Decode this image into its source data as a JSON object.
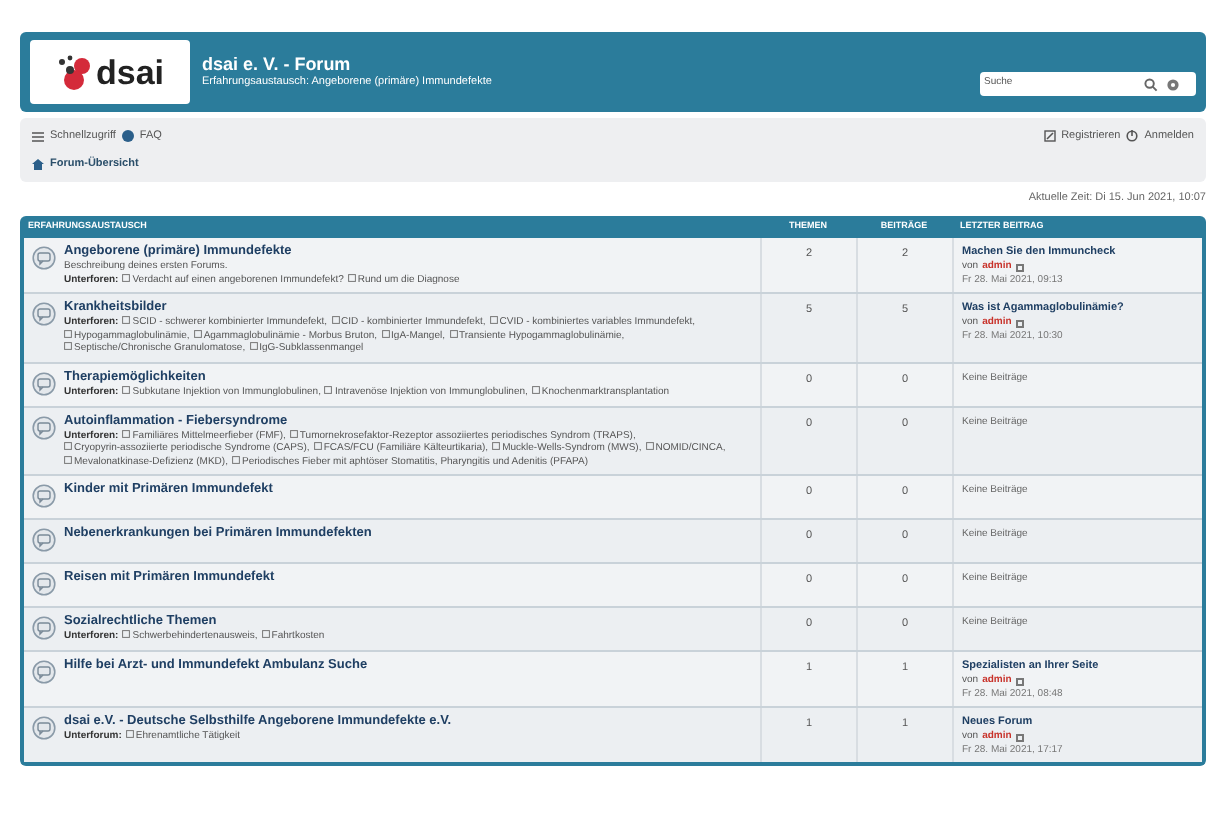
{
  "header": {
    "site_title": "dsai e. V. - Forum",
    "site_description": "Erfahrungsaustausch: Angeborene (primäre) Immundefekte",
    "logo_text": "dsai",
    "search": {
      "placeholder": "Suche"
    }
  },
  "navbar": {
    "left": [
      "Schnellzugriff",
      "FAQ"
    ],
    "right": [
      "Registrieren",
      "Anmelden"
    ],
    "breadcrumb": "Forum-Übersicht"
  },
  "current_time": "Aktuelle Zeit: Di 15. Jun 2021, 10:07",
  "table": {
    "columns": [
      "ERFAHRUNGSAUSTAUSCH",
      "THEMEN",
      "BEITRÄGE",
      "LETZTER BEITRAG"
    ],
    "rows": [
      {
        "title": "Angeborene (primäre) Immundefekte",
        "description": "Beschreibung deines ersten Forums.",
        "subforums_label": "Unterforen:",
        "subforums": [
          "Verdacht auf einen angeborenen Immundefekt?",
          "Rund um die Diagnose"
        ],
        "topics": "2",
        "posts": "2",
        "last_post": {
          "title": "Machen Sie den Immuncheck",
          "by": "von",
          "author": "admin",
          "date": "Fr 28. Mai 2021, 09:13"
        }
      },
      {
        "title": "Krankheitsbilder",
        "subforums_label": "Unterforen:",
        "subforums": [
          "SCID - schwerer kombinierter Immundefekt,",
          "CID - kombinierter Immundefekt,",
          "CVID - kombiniertes variables Immundefekt,",
          "Hypogammaglobulinämie,",
          "Agammaglobulinämie - Morbus Bruton,",
          "IgA-Mangel,",
          "Transiente Hypogammaglobulinämie,",
          "Septische/Chronische Granulomatose,",
          "IgG-Subklassenmangel"
        ],
        "topics": "5",
        "posts": "5",
        "last_post": {
          "title": "Was ist Agammaglobulinämie?",
          "by": "von",
          "author": "admin",
          "date": "Fr 28. Mai 2021, 10:30"
        }
      },
      {
        "title": "Therapiemöglichkeiten",
        "subforums_label": "Unterforen:",
        "subforums": [
          "Subkutane Injektion von Immunglobulinen,",
          "Intravenöse Injektion von Immunglobulinen,",
          "Knochenmarktransplantation"
        ],
        "topics": "0",
        "posts": "0",
        "no_posts": "Keine Beiträge"
      },
      {
        "title": "Autoinflammation - Fiebersyndrome",
        "subforums_label": "Unterforen:",
        "subforums": [
          "Familiäres Mittelmeerfieber (FMF),",
          "Tumornekrosefaktor-Rezeptor assoziiertes periodisches Syndrom (TRAPS),",
          "Cryopyrin-assoziierte periodische Syndrome (CAPS),",
          "FCAS/FCU (Familiäre Kälteurtikaria),",
          "Muckle-Wells-Syndrom (MWS),",
          "NOMID/CINCA,",
          "Mevalonatkinase-Defizienz (MKD),",
          "Periodisches Fieber mit aphtöser Stomatitis, Pharyngitis und Adenitis (PFAPA)"
        ],
        "topics": "0",
        "posts": "0",
        "no_posts": "Keine Beiträge"
      },
      {
        "title": "Kinder mit Primären Immundefekt",
        "topics": "0",
        "posts": "0",
        "no_posts": "Keine Beiträge"
      },
      {
        "title": "Nebenerkrankungen bei Primären Immundefekten",
        "topics": "0",
        "posts": "0",
        "no_posts": "Keine Beiträge"
      },
      {
        "title": "Reisen mit Primären Immundefekt",
        "topics": "0",
        "posts": "0",
        "no_posts": "Keine Beiträge"
      },
      {
        "title": "Sozialrechtliche Themen",
        "subforums_label": "Unterforen:",
        "subforums": [
          "Schwerbehindertenausweis,",
          "Fahrtkosten"
        ],
        "topics": "0",
        "posts": "0",
        "no_posts": "Keine Beiträge"
      },
      {
        "title": "Hilfe bei Arzt- und Immundefekt Ambulanz Suche",
        "topics": "1",
        "posts": "1",
        "last_post": {
          "title": "Spezialisten an Ihrer Seite",
          "by": "von",
          "author": "admin",
          "date": "Fr 28. Mai 2021, 08:48"
        }
      },
      {
        "title": "dsai e.V. - Deutsche Selbsthilfe Angeborene Immundefekte e.V.",
        "subforums_label": "Unterforum:",
        "subforums": [
          "Ehrenamtliche Tätigkeit"
        ],
        "topics": "1",
        "posts": "1",
        "last_post": {
          "title": "Neues Forum",
          "by": "von",
          "author": "admin",
          "date": "Fr 28. Mai 2021, 17:17"
        }
      }
    ]
  }
}
